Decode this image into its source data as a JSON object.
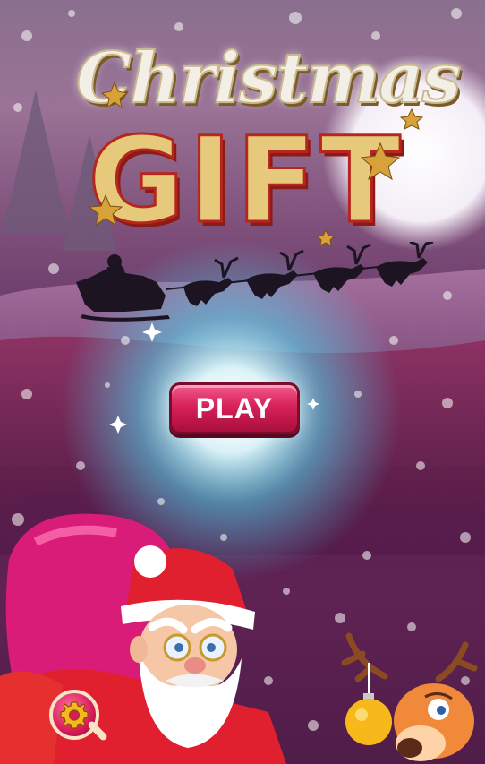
{
  "game": {
    "title_line1": "Christmas",
    "title_line2": "GIFT",
    "play_label": "PLAY"
  },
  "icons": {
    "settings": "gear-icon",
    "sleigh": "santa-sleigh-silhouette",
    "ornament": "christmas-ornament-icon"
  },
  "colors": {
    "play_button": "#d8215a",
    "title_gold": "#e6c97a",
    "title_red_outline": "#b5261f",
    "sky_top": "#8a6f8e",
    "sky_bottom": "#3c1a3c"
  }
}
